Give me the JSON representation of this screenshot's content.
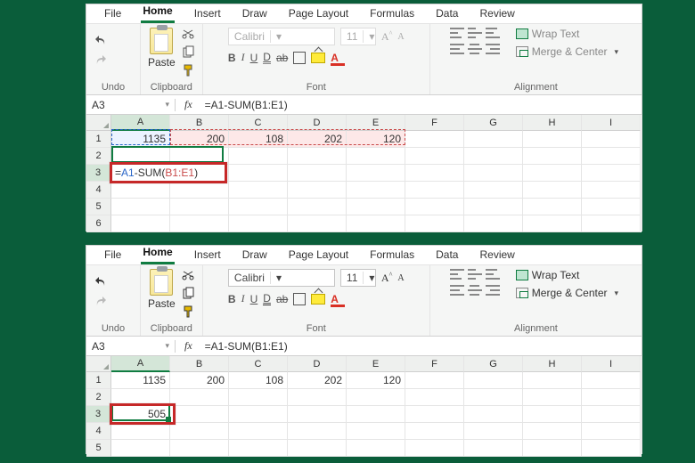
{
  "menu": {
    "file": "File",
    "home": "Home",
    "insert": "Insert",
    "draw": "Draw",
    "pagelayout": "Page Layout",
    "formulas": "Formulas",
    "data": "Data",
    "review": "Review"
  },
  "groups": {
    "undo": "Undo",
    "clipboard": "Clipboard",
    "font": "Font",
    "alignment": "Alignment"
  },
  "clipboard": {
    "paste": "Paste"
  },
  "font": {
    "family": "Calibri",
    "size": "11",
    "bold": "B",
    "italic": "I",
    "underline": "U",
    "strike": "ab"
  },
  "wrap": {
    "wrap": "Wrap Text",
    "merge": "Merge & Center"
  },
  "namebox": "A3",
  "formula": "=A1-SUM(B1:E1)",
  "columns": [
    "A",
    "B",
    "C",
    "D",
    "E",
    "F",
    "G",
    "H",
    "I"
  ],
  "rows": [
    "1",
    "2",
    "3",
    "4",
    "5",
    "6"
  ],
  "rows_bot": [
    "1",
    "2",
    "3",
    "4",
    "5"
  ],
  "top_data": {
    "r1": [
      "1135",
      "200",
      "108",
      "202",
      "120",
      "",
      "",
      "",
      ""
    ],
    "a3_prefix": "=",
    "a3_a1": "A1",
    "a3_mid": "-SUM(",
    "a3_rng": "B1:E1",
    "a3_suf": ")"
  },
  "bot_data": {
    "r1": [
      "1135",
      "200",
      "108",
      "202",
      "120",
      "",
      "",
      "",
      ""
    ],
    "a3": "505"
  }
}
